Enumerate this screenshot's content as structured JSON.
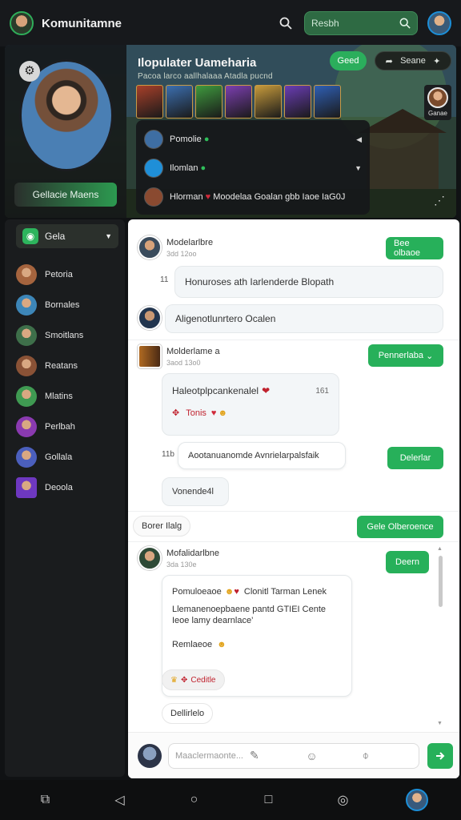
{
  "topbar": {
    "app_title": "Komunitamne",
    "search_placeholder": "Resbh"
  },
  "hero": {
    "profile_button": "Gellacie Maens",
    "title": "Ilopulater Uameharia",
    "subtitle": "Pacoa larco aallhalaaa Atadla pucnd",
    "join_label": "Geed",
    "share_label": "Seane",
    "side_avatar_label": "Ganae",
    "thumb_colors": [
      "#a8402a",
      "#3c6fb0",
      "#3f9a3e",
      "#7c3fb0",
      "#c79b3c",
      "#6a3db4",
      "#2f5fb4"
    ],
    "members": [
      {
        "name": "Pomolie",
        "status_color": "#2fbf5a",
        "chevron": "◀",
        "avatar_color": "#3e6ea3"
      },
      {
        "name": "Ilomlan",
        "status_color": "#2fbf5a",
        "chevron": "▼",
        "avatar_color": "#1f8fd8"
      },
      {
        "name": "Hlorman",
        "status_color": "#d02a3a",
        "chevron": "",
        "avatar_color": "#8a4a30",
        "note": "Moodelaa Goalan gbb Iaoe IaG0J"
      }
    ]
  },
  "sidebar": {
    "select_label": "Gela",
    "items": [
      {
        "label": "Petoria",
        "color": "#a5643e"
      },
      {
        "label": "Bornales",
        "color": "#3d86b8"
      },
      {
        "label": "Smoitlans",
        "color": "#3e6f4a"
      },
      {
        "label": "Reatans",
        "color": "#8a5236"
      },
      {
        "label": "Mlatins",
        "color": "#3f9a52"
      },
      {
        "label": "Perlbah",
        "color": "#8a3ab0"
      },
      {
        "label": "Gollala",
        "color": "#4b5fbd"
      },
      {
        "label": "Deoola",
        "color": "#6e38c0"
      }
    ]
  },
  "chat": {
    "msg1": {
      "name": "Modelarlbre",
      "time": "3dd 12oo",
      "button": "Bee olbaoe",
      "num": "11",
      "bubble": "Honuroses ath Iarlenderde Blopath"
    },
    "msg2": {
      "bubble": "Aligenotlunrtero Ocalen"
    },
    "msg3": {
      "name": "Molderlame a",
      "time": "3aod 13o0",
      "button": "Pennerlaba",
      "bubble_line1": "Haleotplpcankenalel",
      "bubble_num": "161",
      "bubble_line2": "Tonis"
    },
    "msg4": {
      "num": "11b",
      "bubble": "Aootanuanomde Avnrielarpalsfaik",
      "button": "Delerlar"
    },
    "msg5": {
      "bubble": "Vonende4l"
    },
    "row6": {
      "chip": "Borer Ilalg",
      "button": "Gele  Olberoence"
    },
    "msg7": {
      "name": "Mofalidarlbne",
      "time": "3da 130e",
      "button": "Deern",
      "line1": "Pomuloeaoe",
      "line1b": "Clonitl Tarman Lenek",
      "line2": "Llemanenoepbaene  pantd GTIEI Cente",
      "line3": "Ieoe lamy dearnlace’",
      "line4": "Remlaeoe",
      "reaction": "Ceditle"
    },
    "chip_bottom": "Dellirlelo",
    "composer_placeholder": "Maaclermaonte..."
  },
  "colors": {
    "accent": "#27b05a",
    "dark": "#101214"
  }
}
